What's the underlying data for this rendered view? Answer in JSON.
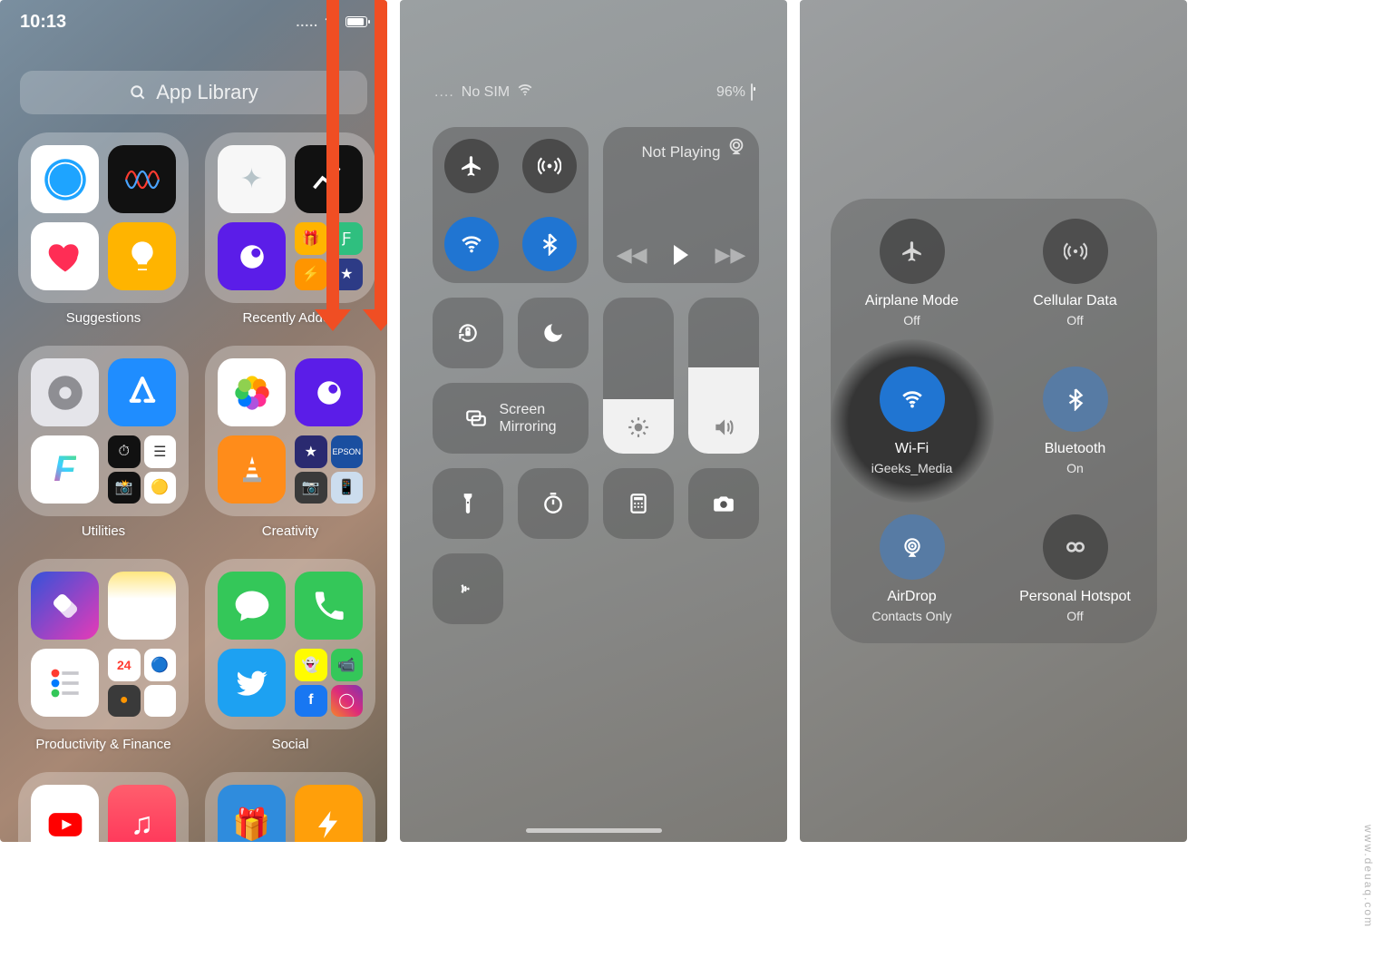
{
  "watermark": "www.deuaq.com",
  "panel1": {
    "time": "10:13",
    "status_dots": ".....",
    "search_placeholder": "App Library",
    "pods": [
      {
        "label": "Suggestions"
      },
      {
        "label": "Recently Added"
      },
      {
        "label": "Utilities"
      },
      {
        "label": "Creativity"
      },
      {
        "label": "Productivity & Finance"
      },
      {
        "label": "Social"
      }
    ]
  },
  "panel2": {
    "carrier": "No SIM",
    "battery_pct": "96%",
    "now_playing": "Not Playing",
    "screen_mirroring_l1": "Screen",
    "screen_mirroring_l2": "Mirroring"
  },
  "panel3": {
    "cells": [
      {
        "title": "Airplane Mode",
        "sub": "Off"
      },
      {
        "title": "Cellular Data",
        "sub": "Off"
      },
      {
        "title": "Wi-Fi",
        "sub": "iGeeks_Media"
      },
      {
        "title": "Bluetooth",
        "sub": "On"
      },
      {
        "title": "AirDrop",
        "sub": "Contacts Only"
      },
      {
        "title": "Personal Hotspot",
        "sub": "Off"
      }
    ]
  }
}
